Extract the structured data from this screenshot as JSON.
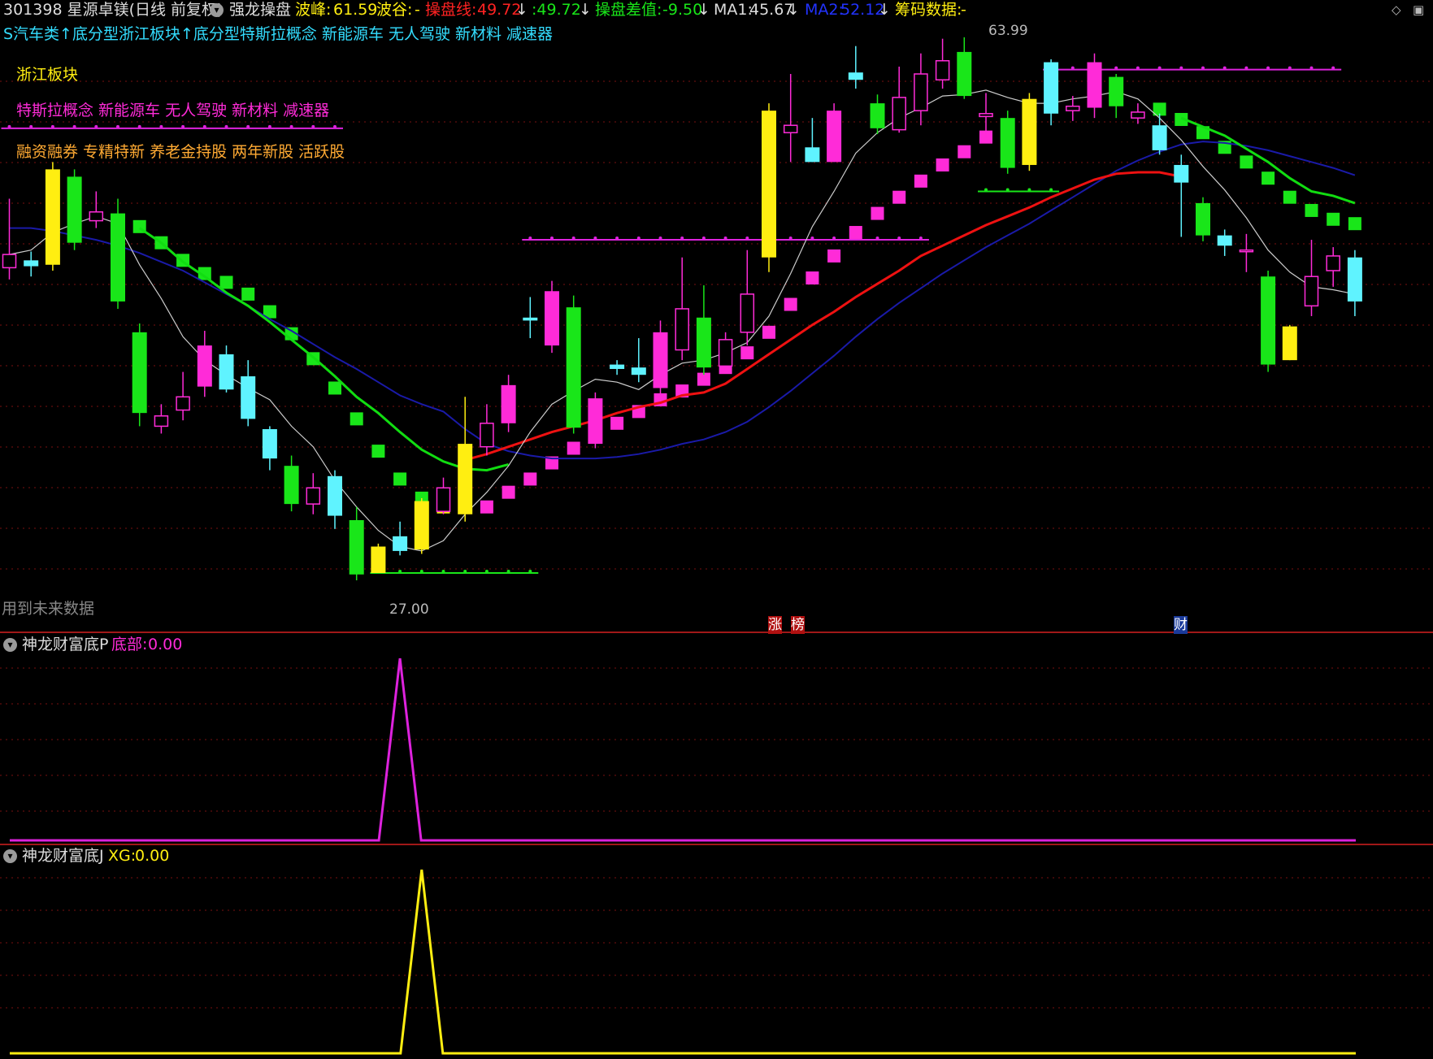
{
  "header": {
    "title": "301398 星源卓镁(日线 前复权)",
    "indicator": "强龙操盘",
    "wave_peak_label": "波峰:",
    "wave_peak_value": "61.59",
    "wave_trough_label": "波谷:",
    "wave_trough_value": "-",
    "control_line_label": "操盘线:",
    "control_line_value": "49.72",
    "control_line_second": ":49.72",
    "control_diff_label": "操盘差值:",
    "control_diff_value": "-9.50",
    "ma1_label": "MA1:",
    "ma1_value": "45.67",
    "ma2_label": "MA2:",
    "ma2_value": "52.12",
    "chip_label": "筹码数据:",
    "chip_value": "-"
  },
  "concept_line": "S汽车类↑底分型浙江板块↑底分型特斯拉概念 新能源车 无人驾驶 新材料 减速器",
  "tags": {
    "sector": "浙江板块",
    "concepts": "特斯拉概念 新能源车 无人驾驶 新材料 减速器",
    "styles": "融资融券 专精特新 养老金持股 两年新股 活跃股"
  },
  "annotations": {
    "high_price": "63.99",
    "low_price": "27.00",
    "future_data": "用到未来数据",
    "flag_zhang": "涨",
    "flag_bang": "榜",
    "flag_cai": "财"
  },
  "panel2": {
    "name": "神龙财富底P",
    "label": "底部:",
    "value": "0.00"
  },
  "panel3": {
    "name": "神龙财富底J",
    "label": "XG:",
    "value": "0.00"
  },
  "colors": {
    "up_magenta": "#ff2bd8",
    "down_green": "#19e619",
    "cyan": "#5ff3ff",
    "yellow": "#ffee11",
    "red_line": "#ee1111",
    "green_line": "#11dd11",
    "blue_line": "#1a1aa8",
    "pink_line": "#dd22dd",
    "grid": "#7a1010"
  },
  "chart_data": {
    "type": "candlestick",
    "price_high": 63.99,
    "price_low": 27.0,
    "candles": [
      {
        "o": 48.7,
        "c": 47.8,
        "h": 52.5,
        "l": 47.0,
        "col": "red"
      },
      {
        "o": 47.9,
        "c": 48.3,
        "h": 48.9,
        "l": 47.2,
        "col": "cyan"
      },
      {
        "o": 48.0,
        "c": 54.5,
        "h": 55.0,
        "l": 47.6,
        "col": "yellow"
      },
      {
        "o": 49.5,
        "c": 54.0,
        "h": 54.5,
        "l": 49.0,
        "col": "green"
      },
      {
        "o": 51.0,
        "c": 51.6,
        "h": 53.0,
        "l": 50.5,
        "col": "red"
      },
      {
        "o": 51.5,
        "c": 45.5,
        "h": 52.5,
        "l": 45.0,
        "col": "green"
      },
      {
        "o": 43.4,
        "c": 37.9,
        "h": 44.0,
        "l": 37.0,
        "col": "green"
      },
      {
        "o": 37.0,
        "c": 37.7,
        "h": 38.5,
        "l": 36.5,
        "col": "red"
      },
      {
        "o": 38.1,
        "c": 39.0,
        "h": 40.7,
        "l": 37.4,
        "col": "red"
      },
      {
        "o": 39.7,
        "c": 42.5,
        "h": 43.5,
        "l": 39.0,
        "col": "magenta"
      },
      {
        "o": 39.5,
        "c": 41.9,
        "h": 42.5,
        "l": 39.3,
        "col": "cyan"
      },
      {
        "o": 37.5,
        "c": 40.4,
        "h": 41.5,
        "l": 37.0,
        "col": "cyan"
      },
      {
        "o": 36.8,
        "c": 34.8,
        "h": 37.0,
        "l": 34.0,
        "col": "cyan"
      },
      {
        "o": 34.3,
        "c": 31.7,
        "h": 35.0,
        "l": 31.2,
        "col": "green"
      },
      {
        "o": 31.7,
        "c": 32.8,
        "h": 33.8,
        "l": 31.0,
        "col": "red"
      },
      {
        "o": 33.6,
        "c": 30.9,
        "h": 34.0,
        "l": 30.0,
        "col": "cyan"
      },
      {
        "o": 30.6,
        "c": 26.9,
        "h": 31.5,
        "l": 26.5,
        "col": "green"
      },
      {
        "o": 27.0,
        "c": 28.8,
        "h": 29.0,
        "l": 27.0,
        "col": "yellow"
      },
      {
        "o": 28.5,
        "c": 29.5,
        "h": 30.5,
        "l": 28.2,
        "col": "cyan"
      },
      {
        "o": 28.6,
        "c": 31.9,
        "h": 32.1,
        "l": 28.3,
        "col": "yellow"
      },
      {
        "o": 31.2,
        "c": 32.8,
        "h": 33.5,
        "l": 31.0,
        "col": "red"
      },
      {
        "o": 31.0,
        "c": 35.8,
        "h": 39.0,
        "l": 30.5,
        "col": "yellow"
      },
      {
        "o": 35.6,
        "c": 37.2,
        "h": 38.5,
        "l": 35.0,
        "col": "red"
      },
      {
        "o": 37.2,
        "c": 39.8,
        "h": 40.5,
        "l": 36.6,
        "col": "magenta"
      },
      {
        "o": 44.4,
        "c": 44.2,
        "h": 45.8,
        "l": 43.0,
        "col": "cyan"
      },
      {
        "o": 42.5,
        "c": 46.2,
        "h": 46.9,
        "l": 42.0,
        "col": "magenta"
      },
      {
        "o": 45.1,
        "c": 36.9,
        "h": 45.9,
        "l": 36.5,
        "col": "green"
      },
      {
        "o": 35.8,
        "c": 38.9,
        "h": 39.3,
        "l": 35.5,
        "col": "magenta"
      },
      {
        "o": 40.9,
        "c": 41.2,
        "h": 41.5,
        "l": 40.5,
        "col": "cyan"
      },
      {
        "o": 40.5,
        "c": 41.0,
        "h": 43.0,
        "l": 40.0,
        "col": "cyan"
      },
      {
        "o": 39.6,
        "c": 43.4,
        "h": 44.2,
        "l": 39.0,
        "col": "magenta"
      },
      {
        "o": 42.2,
        "c": 45.0,
        "h": 48.5,
        "l": 41.5,
        "col": "red"
      },
      {
        "o": 44.4,
        "c": 41.0,
        "h": 46.6,
        "l": 40.5,
        "col": "green"
      },
      {
        "o": 41.1,
        "c": 42.9,
        "h": 43.4,
        "l": 40.8,
        "col": "red"
      },
      {
        "o": 43.4,
        "c": 46.0,
        "h": 49.0,
        "l": 42.5,
        "col": "red"
      },
      {
        "o": 48.5,
        "c": 58.5,
        "h": 59.0,
        "l": 47.5,
        "col": "yellow"
      },
      {
        "o": 57.0,
        "c": 57.5,
        "h": 61.0,
        "l": 55.0,
        "col": "red"
      },
      {
        "o": 55.0,
        "c": 56.0,
        "h": 58.0,
        "l": 55.0,
        "col": "cyan"
      },
      {
        "o": 55.0,
        "c": 58.5,
        "h": 59.0,
        "l": 55.0,
        "col": "magenta"
      },
      {
        "o": 60.6,
        "c": 61.1,
        "h": 62.9,
        "l": 60.0,
        "col": "cyan"
      },
      {
        "o": 59.0,
        "c": 57.3,
        "h": 59.6,
        "l": 56.9,
        "col": "green"
      },
      {
        "o": 57.2,
        "c": 59.4,
        "h": 61.5,
        "l": 57.0,
        "col": "red"
      },
      {
        "o": 58.5,
        "c": 61.0,
        "h": 62.4,
        "l": 57.5,
        "col": "red"
      },
      {
        "o": 60.6,
        "c": 61.9,
        "h": 63.4,
        "l": 60.0,
        "col": "red"
      },
      {
        "o": 62.5,
        "c": 59.5,
        "h": 63.5,
        "l": 59.3,
        "col": "green"
      },
      {
        "o": 58.3,
        "c": 58.1,
        "h": 59.7,
        "l": 56.6,
        "col": "red"
      },
      {
        "o": 58.0,
        "c": 54.6,
        "h": 58.5,
        "l": 54.2,
        "col": "green"
      },
      {
        "o": 54.8,
        "c": 59.3,
        "h": 59.7,
        "l": 54.4,
        "col": "yellow"
      },
      {
        "o": 58.3,
        "c": 61.8,
        "h": 62.0,
        "l": 57.5,
        "col": "cyan"
      },
      {
        "o": 58.5,
        "c": 58.8,
        "h": 59.5,
        "l": 57.8,
        "col": "red"
      },
      {
        "o": 58.7,
        "c": 61.8,
        "h": 62.4,
        "l": 58.0,
        "col": "magenta"
      },
      {
        "o": 60.8,
        "c": 58.8,
        "h": 61.0,
        "l": 58.0,
        "col": "green"
      },
      {
        "o": 58.4,
        "c": 58.0,
        "h": 59.0,
        "l": 57.6,
        "col": "red"
      },
      {
        "o": 57.5,
        "c": 55.8,
        "h": 58.3,
        "l": 55.5,
        "col": "cyan"
      },
      {
        "o": 54.8,
        "c": 53.6,
        "h": 55.5,
        "l": 49.9,
        "col": "cyan"
      },
      {
        "o": 52.2,
        "c": 50.0,
        "h": 52.6,
        "l": 49.6,
        "col": "green"
      },
      {
        "o": 50.0,
        "c": 49.3,
        "h": 50.4,
        "l": 48.6,
        "col": "cyan"
      },
      {
        "o": 49.0,
        "c": 49.0,
        "h": 50.1,
        "l": 47.5,
        "col": "red"
      },
      {
        "o": 47.2,
        "c": 41.2,
        "h": 47.6,
        "l": 40.7,
        "col": "green"
      },
      {
        "o": 43.8,
        "c": 41.5,
        "h": 43.9,
        "l": 41.5,
        "col": "yellow"
      },
      {
        "o": 45.2,
        "c": 47.2,
        "h": 49.7,
        "l": 44.5,
        "col": "red"
      },
      {
        "o": 47.6,
        "c": 48.6,
        "h": 49.2,
        "l": 46.5,
        "col": "red"
      },
      {
        "o": 45.5,
        "c": 48.5,
        "h": 49.0,
        "l": 44.5,
        "col": "cyan"
      }
    ],
    "ma_fast": [
      48.7,
      49.0,
      50.2,
      50.8,
      51.3,
      50.8,
      48.0,
      45.7,
      43.1,
      41.5,
      40.5,
      39.6,
      38.8,
      37.0,
      35.6,
      33.3,
      31.5,
      29.9,
      28.8,
      28.5,
      29.2,
      31.0,
      32.5,
      34.3,
      36.6,
      38.5,
      39.4,
      40.2,
      40.0,
      39.5,
      40.5,
      41.3,
      41.5,
      42.0,
      42.7,
      44.5,
      47.4,
      50.6,
      53.0,
      55.6,
      57.0,
      58.0,
      58.7,
      59.5,
      59.6,
      59.9,
      59.4,
      59.0,
      59.0,
      59.3,
      59.5,
      59.8,
      59.3,
      58.0,
      56.5,
      54.7,
      53.1,
      51.2,
      49.0,
      47.5,
      46.5,
      46.3,
      46.0
    ],
    "ma_green": [
      null,
      null,
      null,
      null,
      null,
      null,
      50.5,
      49.5,
      48.2,
      47.2,
      46.1,
      45.2,
      44.1,
      42.9,
      41.7,
      40.4,
      39.0,
      37.9,
      36.6,
      35.4,
      34.6,
      34.1,
      34.0,
      34.4,
      null,
      null,
      null,
      null,
      null,
      null,
      null,
      null,
      null,
      null,
      null,
      null,
      null,
      null,
      null,
      null,
      null,
      null,
      null,
      null,
      null,
      null,
      null,
      null,
      null,
      null,
      null,
      null,
      null,
      null,
      58.0,
      57.4,
      56.8,
      55.9,
      55.0,
      53.9,
      53.0,
      52.7,
      52.2
    ],
    "ma_red": [
      null,
      null,
      null,
      null,
      null,
      null,
      null,
      null,
      null,
      null,
      null,
      null,
      null,
      null,
      null,
      null,
      null,
      null,
      null,
      null,
      null,
      34.7,
      35.1,
      35.6,
      36.1,
      36.6,
      37.0,
      37.4,
      37.9,
      38.3,
      38.6,
      39.1,
      39.3,
      39.9,
      40.9,
      41.9,
      42.9,
      43.9,
      44.8,
      45.8,
      46.7,
      47.6,
      48.6,
      49.3,
      50.0,
      50.7,
      51.3,
      51.9,
      52.6,
      53.2,
      53.8,
      54.2,
      54.3,
      54.3,
      54.0,
      null,
      null,
      null,
      null,
      null,
      null,
      null,
      null
    ],
    "ma_blue": [
      50.5,
      50.5,
      50.3,
      50.0,
      49.7,
      49.3,
      48.8,
      48.2,
      47.6,
      46.8,
      46.0,
      45.2,
      44.3,
      43.5,
      42.6,
      41.7,
      40.9,
      40.0,
      39.1,
      38.5,
      38.0,
      36.8,
      35.8,
      35.3,
      35.0,
      34.8,
      34.8,
      34.8,
      34.9,
      35.1,
      35.4,
      35.8,
      36.1,
      36.6,
      37.3,
      38.3,
      39.4,
      40.6,
      41.8,
      43.1,
      44.3,
      45.4,
      46.4,
      47.4,
      48.3,
      49.2,
      50.0,
      50.8,
      51.7,
      52.6,
      53.5,
      54.4,
      55.1,
      55.7,
      56.2,
      56.4,
      56.3,
      56.1,
      55.8,
      55.4,
      55.0,
      54.6,
      54.1
    ],
    "steps": [
      {
        "i": 6,
        "v": 50.6,
        "col": "green"
      },
      {
        "i": 7,
        "v": 49.5,
        "col": "green"
      },
      {
        "i": 8,
        "v": 48.3,
        "col": "green"
      },
      {
        "i": 9,
        "v": 47.4,
        "col": "green"
      },
      {
        "i": 10,
        "v": 46.8,
        "col": "green"
      },
      {
        "i": 11,
        "v": 46.0,
        "col": "green"
      },
      {
        "i": 12,
        "v": 44.8,
        "col": "green"
      },
      {
        "i": 13,
        "v": 43.3,
        "col": "green"
      },
      {
        "i": 14,
        "v": 41.6,
        "col": "green"
      },
      {
        "i": 15,
        "v": 39.6,
        "col": "green"
      },
      {
        "i": 16,
        "v": 37.5,
        "col": "green"
      },
      {
        "i": 17,
        "v": 35.3,
        "col": "green"
      },
      {
        "i": 18,
        "v": 33.4,
        "col": "green"
      },
      {
        "i": 19,
        "v": 32.1,
        "col": "green"
      },
      {
        "i": 20,
        "v": 31.5,
        "col": "yellow"
      },
      {
        "i": 22,
        "v": 31.5,
        "col": "magenta"
      },
      {
        "i": 23,
        "v": 32.5,
        "col": "magenta"
      },
      {
        "i": 24,
        "v": 33.4,
        "col": "magenta"
      },
      {
        "i": 25,
        "v": 34.5,
        "col": "magenta"
      },
      {
        "i": 26,
        "v": 35.5,
        "col": "magenta"
      },
      {
        "i": 28,
        "v": 37.2,
        "col": "magenta"
      },
      {
        "i": 29,
        "v": 38.0,
        "col": "magenta"
      },
      {
        "i": 30,
        "v": 38.8,
        "col": "magenta"
      },
      {
        "i": 31,
        "v": 39.4,
        "col": "magenta"
      },
      {
        "i": 32,
        "v": 40.2,
        "col": "magenta"
      },
      {
        "i": 33,
        "v": 41.0,
        "col": "magenta"
      },
      {
        "i": 34,
        "v": 42.0,
        "col": "magenta"
      },
      {
        "i": 35,
        "v": 43.4,
        "col": "magenta"
      },
      {
        "i": 36,
        "v": 45.3,
        "col": "magenta"
      },
      {
        "i": 37,
        "v": 47.1,
        "col": "magenta"
      },
      {
        "i": 38,
        "v": 48.6,
        "col": "magenta"
      },
      {
        "i": 39,
        "v": 50.2,
        "col": "magenta"
      },
      {
        "i": 40,
        "v": 51.5,
        "col": "magenta"
      },
      {
        "i": 41,
        "v": 52.6,
        "col": "magenta"
      },
      {
        "i": 42,
        "v": 53.7,
        "col": "magenta"
      },
      {
        "i": 43,
        "v": 54.8,
        "col": "magenta"
      },
      {
        "i": 44,
        "v": 55.7,
        "col": "magenta"
      },
      {
        "i": 45,
        "v": 56.7,
        "col": "magenta"
      },
      {
        "i": 53,
        "v": 58.6,
        "col": "green"
      },
      {
        "i": 54,
        "v": 57.9,
        "col": "green"
      },
      {
        "i": 55,
        "v": 57.0,
        "col": "green"
      },
      {
        "i": 56,
        "v": 56.0,
        "col": "green"
      },
      {
        "i": 57,
        "v": 55.0,
        "col": "green"
      },
      {
        "i": 58,
        "v": 53.9,
        "col": "green"
      },
      {
        "i": 59,
        "v": 52.6,
        "col": "green"
      },
      {
        "i": 60,
        "v": 51.7,
        "col": "green"
      },
      {
        "i": 61,
        "v": 51.1,
        "col": "green"
      },
      {
        "i": 62,
        "v": 50.8,
        "col": "green"
      }
    ],
    "dotted_levels": [
      {
        "from": 0,
        "to": 15,
        "v": 57.3
      },
      {
        "from": 24,
        "to": 42,
        "v": 49.7
      },
      {
        "from": 48,
        "to": 61,
        "v": 61.3
      },
      {
        "from": 17,
        "to": 24,
        "v": 27.0
      },
      {
        "from": 45,
        "to": 48,
        "v": 53.0
      }
    ],
    "panel2_peak_index": 18,
    "panel3_peak_index": 19
  }
}
